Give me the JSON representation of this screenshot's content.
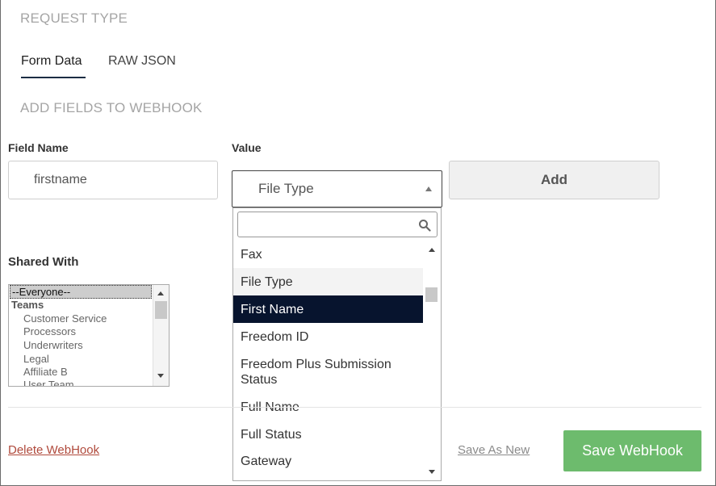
{
  "request_type": {
    "title": "REQUEST TYPE"
  },
  "tabs": [
    {
      "label": "Form Data",
      "active": true
    },
    {
      "label": "RAW JSON",
      "active": false
    }
  ],
  "add_fields": {
    "title": "ADD FIELDS TO WEBHOOK"
  },
  "field_name": {
    "label": "Field Name",
    "value": "firstname"
  },
  "value_field": {
    "label": "Value",
    "selected": "File Type",
    "search_placeholder": "",
    "options": [
      "Fax",
      "File Type",
      "First Name",
      "Freedom ID",
      "Freedom Plus Submission Status",
      "Full Name",
      "Full Status",
      "Gateway"
    ],
    "hovered": "File Type",
    "highlighted": "First Name"
  },
  "add_button": {
    "label": "Add"
  },
  "shared_with": {
    "label": "Shared With",
    "selected": "--Everyone--",
    "group": "Teams",
    "options": [
      "Customer Service",
      "Processors",
      "Underwriters",
      "Legal",
      "Affiliate B",
      "User Team"
    ]
  },
  "footer": {
    "delete_label": "Delete WebHook",
    "save_as_new_label": "Save As New",
    "save_label": "Save WebHook"
  },
  "colors": {
    "accent_dark": "#07142e",
    "save_green": "#6dbb6d",
    "delete_red": "#b04a3c"
  },
  "icons": {
    "search": "search-icon"
  }
}
